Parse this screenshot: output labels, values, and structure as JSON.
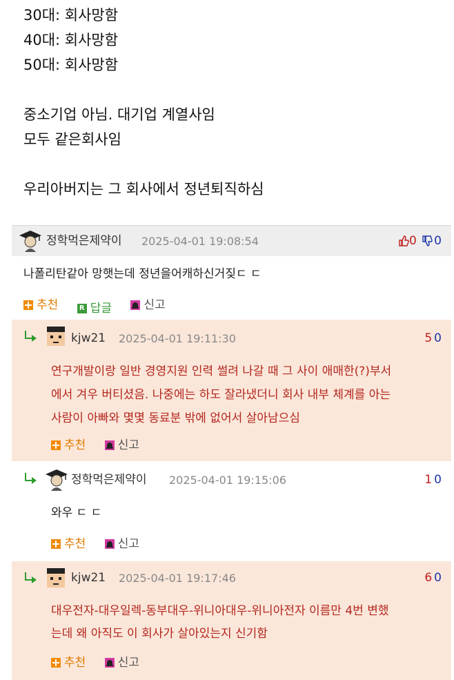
{
  "post": {
    "lines": [
      "30대: 회사망함",
      "40대: 회사망함",
      "50대: 회사망함",
      "",
      "중소기업 아님. 대기업 계열사임",
      "모두 같은회사임",
      "",
      "우리아버지는 그 회사에서 정년퇴직하심"
    ]
  },
  "actions": {
    "recommend": "추천",
    "reply": "답글",
    "report": "신고",
    "reply_icon_letter": "R"
  },
  "comments": [
    {
      "nick": "정학먹은제약이",
      "date": "2025-04-01 19:08:54",
      "up": "0",
      "down": "0",
      "text": [
        "나폴리탄같아 망햇는데 정년을어캐하신거짖ㄷ ㄷ"
      ],
      "avatar": "graduate-avatar-icon"
    },
    {
      "nick": "kjw21",
      "date": "2025-04-01 19:11:30",
      "up": "5",
      "down": "0",
      "text": [
        "연구개발이랑 일반 경영지원 인력 썰려 나갈 때 그 사이 애매한(?)부서",
        "에서 겨우 버티셨음. 나중에는 하도 잘라냈더니 회사 내부 체계를 아는",
        "사람이 아빠와 몇몇 동료분 밖에 없어서 살아남으심"
      ],
      "avatar": "pixel-face-avatar-icon"
    },
    {
      "nick": "정학먹은제약이",
      "date": "2025-04-01 19:15:06",
      "up": "1",
      "down": "0",
      "text": [
        "와우 ㄷ ㄷ"
      ],
      "avatar": "graduate-avatar-icon"
    },
    {
      "nick": "kjw21",
      "date": "2025-04-01 19:17:46",
      "up": "6",
      "down": "0",
      "text": [
        "대우전자-대우일렉-동부대우-위니아대우-위니아전자 이름만 4번 변했",
        "는데 왜 아직도 이 회사가 살아있는지 신기함"
      ],
      "avatar": "pixel-face-avatar-icon"
    }
  ],
  "colors": {
    "highlight": "#fbe7da",
    "reply_arrow": "#2e9b2e",
    "upvote": "#c21d1d",
    "downvote": "#1d35a8",
    "author_text": "#b3261e"
  }
}
